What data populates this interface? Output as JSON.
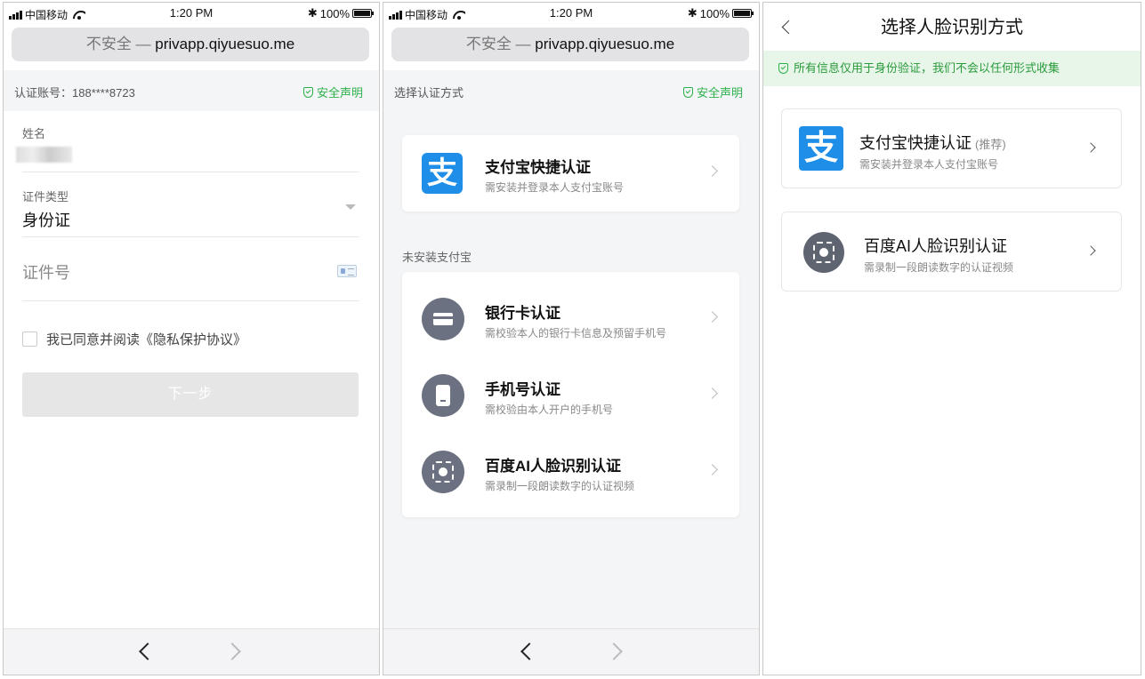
{
  "status": {
    "carrier": "中国移动",
    "time": "1:20 PM",
    "battery": "100%"
  },
  "browser": {
    "insecure_label": "不安全",
    "dash": " — ",
    "url": "privapp.qiyuesuo.me"
  },
  "p1": {
    "account": "认证账号：188****8723",
    "security": "安全声明",
    "name_label": "姓名",
    "idtype_label": "证件类型",
    "idtype_value": "身份证",
    "idnum_placeholder": "证件号",
    "agree_text": "我已同意并阅读《隐私保护协议》",
    "next_button": "下一步"
  },
  "p2": {
    "header_left": "选择认证方式",
    "security": "安全声明",
    "alipay_title": "支付宝快捷认证",
    "alipay_sub": "需安装并登录本人支付宝账号",
    "alipay_glyph": "支",
    "section_label": "未安装支付宝",
    "options": [
      {
        "title": "银行卡认证",
        "sub": "需校验本人的银行卡信息及预留手机号"
      },
      {
        "title": "手机号认证",
        "sub": "需校验由本人开户的手机号"
      },
      {
        "title": "百度AI人脸识别认证",
        "sub": "需录制一段朗读数字的认证视频"
      }
    ]
  },
  "p3": {
    "title": "选择人脸识别方式",
    "notice": "所有信息仅用于身份验证，我们不会以任何形式收集",
    "alipay_title": "支付宝快捷认证",
    "alipay_tag": "(推荐)",
    "alipay_sub": "需安装并登录本人支付宝账号",
    "alipay_glyph": "支",
    "face_title": "百度AI人脸识别认证",
    "face_sub": "需录制一段朗读数字的认证视频"
  },
  "colors": {
    "accent_green": "#2db14a",
    "alipay_blue": "#1f8ee8",
    "icon_gray": "#6b7180"
  }
}
